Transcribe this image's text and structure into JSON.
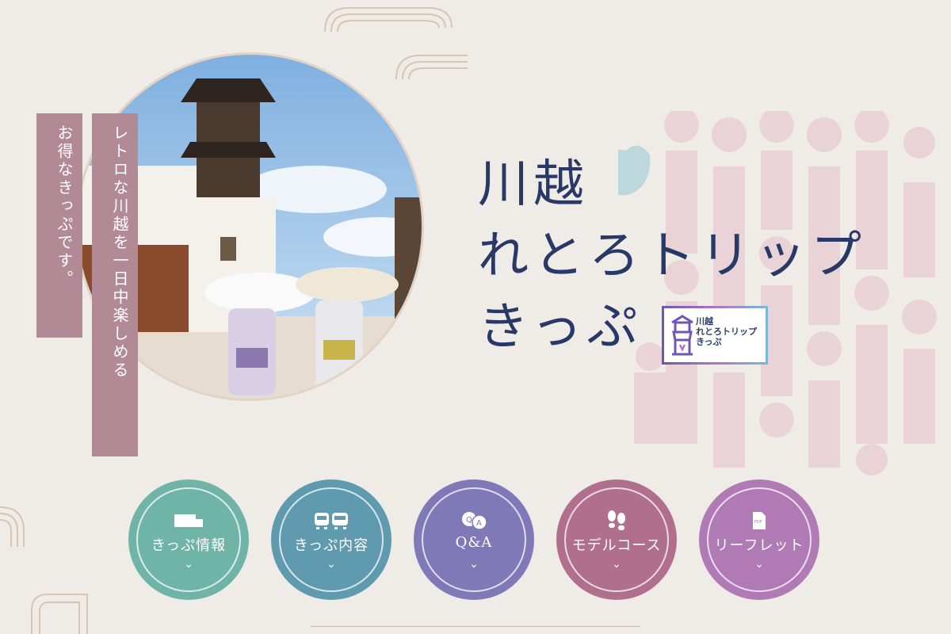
{
  "hero": {
    "banner_left": "お得なきっぷです。",
    "banner_right": "レトロな川越を一日中楽しめる"
  },
  "title": {
    "line1": "川越",
    "line2": "れとろトリップ",
    "line3": "きっぷ"
  },
  "logo": {
    "line1": "川越",
    "line2": "れとろトリップ",
    "line3": "きっぷ"
  },
  "nav": [
    {
      "label": "きっぷ情報",
      "icon": "ticket-icon",
      "color": "#6fb4a7"
    },
    {
      "label": "きっぷ内容",
      "icon": "train-bus-icon",
      "color": "#5f9aae"
    },
    {
      "label": "Q&A",
      "icon": "qa-icon",
      "color": "#7f79b8"
    },
    {
      "label": "モデルコース",
      "icon": "footprints-icon",
      "color": "#b0708d"
    },
    {
      "label": "リーフレット",
      "icon": "pdf-icon",
      "color": "#b07ab5"
    }
  ],
  "colors": {
    "background": "#efece7",
    "banner": "#b18a95",
    "title": "#283968"
  }
}
